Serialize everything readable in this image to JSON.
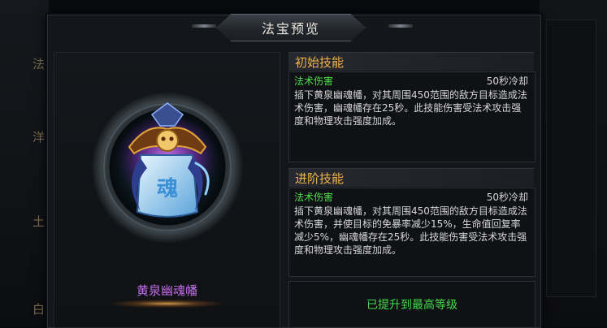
{
  "dialog": {
    "title": "法宝预览"
  },
  "background_fragments": {
    "top": "法",
    "middle": "洋",
    "lower": "土",
    "bottom": "白"
  },
  "item": {
    "name": "黄泉幽魂幡",
    "icon": "soul-banner-icon",
    "name_color": "#c36bea"
  },
  "initial_skill": {
    "header": "初始技能",
    "type": "法术伤害",
    "cooldown": "50秒冷却",
    "description": "插下黄泉幽魂幡，对其周围450范围的敌方目标造成法术伤害，幽魂幡存在25秒。此技能伤害受法术攻击强度和物理攻击强度加成。"
  },
  "advanced_skill": {
    "header": "进阶技能",
    "type": "法术伤害",
    "cooldown": "50秒冷却",
    "description": "插下黄泉幽魂幡，对其周围450范围的敌方目标造成法术伤害，并使目标的免暴率减少15%，生命值回复率减少5%，幽魂幡存在25秒。此技能伤害受法术攻击强度和物理攻击强度加成。"
  },
  "status": {
    "max_level": "已提升到最高等级"
  },
  "colors": {
    "header_gold": "#f0b24a",
    "skill_type_green": "#4fe04b",
    "max_level_green": "#46d94a"
  }
}
